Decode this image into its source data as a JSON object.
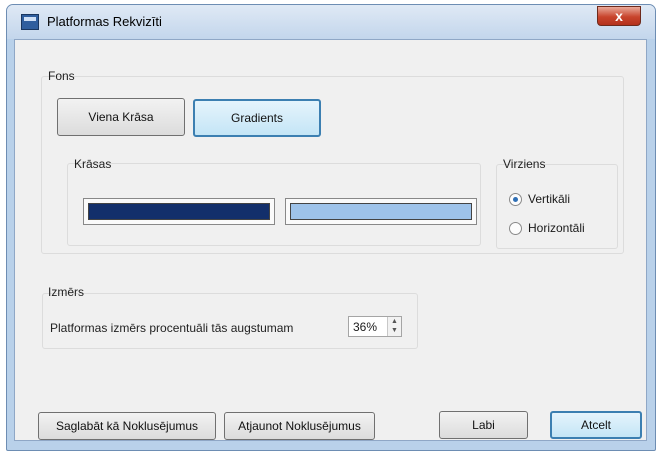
{
  "window": {
    "title": "Platformas Rekvizīti",
    "close_label": "x"
  },
  "fons": {
    "group_label": "Fons",
    "solid_label": "Viena Krāsa",
    "gradient_label": "Gradients",
    "krasas_label": "Krāsas",
    "color1": "#132f6b",
    "color2": "#9ec3ea"
  },
  "virziens": {
    "group_label": "Virziens",
    "vertical_label": "Vertikāli",
    "horizontal_label": "Horizontāli",
    "selected": "vertical"
  },
  "izmers": {
    "group_label": "Izmērs",
    "size_label": "Platformas izmērs procentuāli tās augstumam",
    "size_value": "36%"
  },
  "buttons": {
    "save_default": "Saglabāt kā Noklusējumus",
    "restore_default": "Atjaunot Noklusējumus",
    "ok": "Labi",
    "cancel": "Atcelt"
  }
}
